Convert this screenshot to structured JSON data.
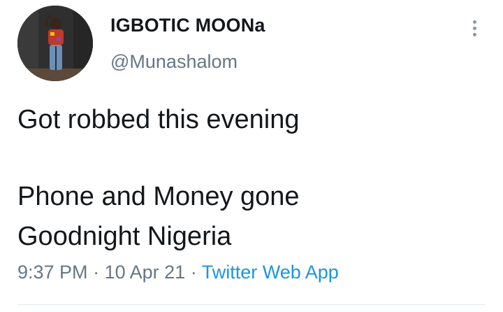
{
  "author": {
    "display_name": "IGBOTIC MOONa",
    "handle": "@Munashalom"
  },
  "tweet": {
    "line1": "Got robbed this evening",
    "line2": "Phone and Money gone",
    "line3": "Goodnight Nigeria"
  },
  "meta": {
    "time": "9:37 PM",
    "separator": "·",
    "date": "10 Apr 21",
    "source": "Twitter Web App"
  },
  "icons": {
    "more": "more-vertical-icon"
  },
  "colors": {
    "text": "#14171a",
    "secondary": "#657786",
    "link": "#1b95e0"
  }
}
